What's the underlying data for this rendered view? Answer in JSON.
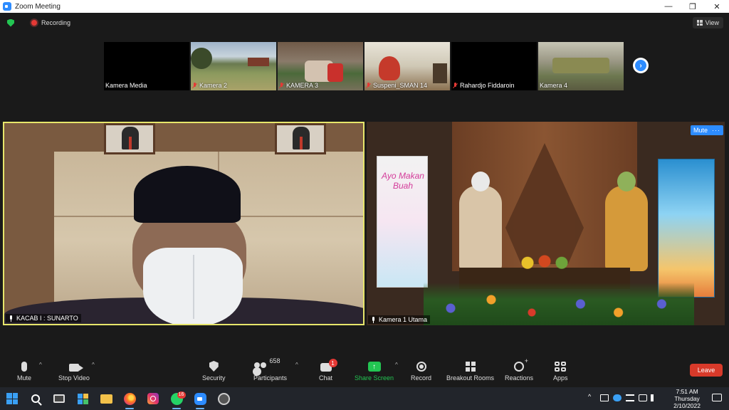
{
  "window": {
    "title": "Zoom Meeting",
    "controls": [
      "—",
      "❐",
      "✕"
    ]
  },
  "meeting_bar": {
    "recording_label": "Recording",
    "view_label": "View"
  },
  "thumbnails": [
    {
      "name": "Kamera Media",
      "muted": false
    },
    {
      "name": "Kamera 2",
      "muted": true
    },
    {
      "name": "KAMERA 3",
      "muted": true
    },
    {
      "name": "Suspeni_SMAN 14",
      "muted": true
    },
    {
      "name": "Rahardjo Fiddaroin",
      "muted": true
    },
    {
      "name": "Kamera 4",
      "muted": false
    }
  ],
  "next_page_symbol": "›",
  "main_tiles": {
    "left_name": "KACAB I : SUNARTO",
    "right_name": "Kamera 1 Utama",
    "right_mute_label": "Mute",
    "right_more_label": "···"
  },
  "stage": {
    "banner_left_text": "Ayo Makan Buah"
  },
  "toolbar": {
    "mute_label": "Mute",
    "stop_video_label": "Stop Video",
    "security_label": "Security",
    "participants_label": "Participants",
    "participants_count": "658",
    "chat_label": "Chat",
    "chat_badge": "1",
    "share_label": "Share Screen",
    "share_symbol": "↑",
    "record_label": "Record",
    "breakout_label": "Breakout Rooms",
    "reactions_label": "Reactions",
    "apps_label": "Apps",
    "leave_label": "Leave",
    "caret": "^"
  },
  "taskbar": {
    "whatsapp_badge": "16",
    "time": "7:51 AM",
    "day": "Thursday",
    "date": "2/10/2022",
    "tray_up": "^"
  },
  "colors": {
    "zoom_blue": "#2d8cff",
    "share_green": "#23c552",
    "leave_red": "#d83a2a",
    "active_speaker": "#e7e66b"
  }
}
